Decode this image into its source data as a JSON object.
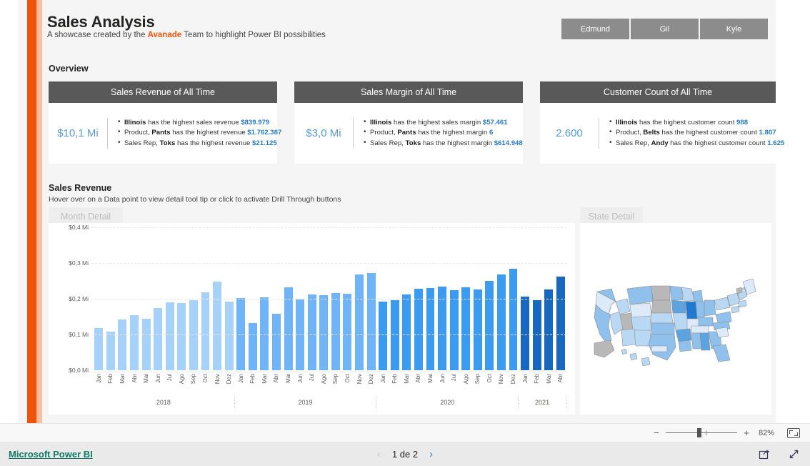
{
  "header": {
    "title": "Sales Analysis",
    "subtitle_before": "A showcase created by the ",
    "brand": "Avanade",
    "subtitle_after": " Team to highlight Power BI possibilities",
    "nav_buttons": [
      {
        "label": "Edmund"
      },
      {
        "label": "Gil"
      },
      {
        "label": "Kyle"
      }
    ]
  },
  "overview": {
    "label": "Overview",
    "cards": [
      {
        "title": "Sales Revenue of All Time",
        "value": "$10,1 Mi",
        "bullets": [
          {
            "bold": "Illinois",
            "text": " has the highest sales revenue ",
            "highlight": "$839.979",
            "prefix": ""
          },
          {
            "bold": "Pants",
            "text": " has the highest revenue ",
            "highlight": "$1.762.387",
            "prefix": "Product, "
          },
          {
            "bold": "Toks",
            "text": " has the highest revenue ",
            "highlight": "$21.125",
            "prefix": "Sales Rep, "
          }
        ]
      },
      {
        "title": "Sales Margin of All Time",
        "value": "$3,0 Mi",
        "bullets": [
          {
            "bold": "Illinois",
            "text": " has the highest sales margin ",
            "highlight": "$57.461",
            "prefix": ""
          },
          {
            "bold": "Pants",
            "text": " has the highest margin ",
            "highlight": "6",
            "prefix": "Product, "
          },
          {
            "bold": "Toks",
            "text": " has the highest margin ",
            "highlight": "$614.948",
            "prefix": "Sales Rep, "
          }
        ]
      },
      {
        "title": "Customer Count of All Time",
        "value": "2.600",
        "bullets": [
          {
            "bold": "Illinois",
            "text": " has the highest customer count ",
            "highlight": "988",
            "prefix": ""
          },
          {
            "bold": "Belts",
            "text": " has the highest customer count ",
            "highlight": "1.807",
            "prefix": "Product, "
          },
          {
            "bold": "Andy",
            "text": " has the highest customer count ",
            "highlight": "1.625",
            "prefix": "Sales Rep, "
          }
        ]
      }
    ]
  },
  "sales_revenue": {
    "label": "Sales Revenue",
    "hint": "Hover over on a Data point to view detail tool tip or click to activate Drill Through buttons",
    "month_tab": "Month Detail",
    "state_tab": "State Detail"
  },
  "chart_data": {
    "type": "bar",
    "title": "Sales Revenue",
    "xlabel": "",
    "ylabel": "",
    "ylim": [
      0,
      0.4
    ],
    "grid": true,
    "legend": "none",
    "ytick_labels": [
      "$0,4 Mi",
      "$0,3 Mi",
      "$0,2 Mi",
      "$0,1 Mi",
      "$0,0 Mi"
    ],
    "ytick_values": [
      0.4,
      0.3,
      0.2,
      0.1,
      0.0
    ],
    "year_groups": [
      {
        "year": "2018",
        "count": 12
      },
      {
        "year": "2019",
        "count": 12
      },
      {
        "year": "2020",
        "count": 12
      },
      {
        "year": "2021",
        "count": 4
      }
    ],
    "series_colors": {
      "2018": "#a6d2fa",
      "2019": "#6fb4f7",
      "2020": "#3a9bf0",
      "2021": "#1868c0"
    },
    "points": [
      {
        "x": "Jan",
        "year": "2018",
        "value": 0.118
      },
      {
        "x": "Feb",
        "year": "2018",
        "value": 0.108
      },
      {
        "x": "Mar",
        "year": "2018",
        "value": 0.143
      },
      {
        "x": "Abr",
        "year": "2018",
        "value": 0.155
      },
      {
        "x": "Mai",
        "year": "2018",
        "value": 0.144
      },
      {
        "x": "Jun",
        "year": "2018",
        "value": 0.175
      },
      {
        "x": "Jul",
        "year": "2018",
        "value": 0.191
      },
      {
        "x": "Ago",
        "year": "2018",
        "value": 0.188
      },
      {
        "x": "Sep",
        "year": "2018",
        "value": 0.196
      },
      {
        "x": "Oct",
        "year": "2018",
        "value": 0.218
      },
      {
        "x": "Nov",
        "year": "2018",
        "value": 0.248
      },
      {
        "x": "Dez",
        "year": "2018",
        "value": 0.192
      },
      {
        "x": "Jan",
        "year": "2019",
        "value": 0.202
      },
      {
        "x": "Feb",
        "year": "2019",
        "value": 0.133
      },
      {
        "x": "Mar",
        "year": "2019",
        "value": 0.204
      },
      {
        "x": "Abr",
        "year": "2019",
        "value": 0.159
      },
      {
        "x": "Mai",
        "year": "2019",
        "value": 0.232
      },
      {
        "x": "Jun",
        "year": "2019",
        "value": 0.198
      },
      {
        "x": "Jul",
        "year": "2019",
        "value": 0.212
      },
      {
        "x": "Ago",
        "year": "2019",
        "value": 0.21
      },
      {
        "x": "Sep",
        "year": "2019",
        "value": 0.216
      },
      {
        "x": "Oct",
        "year": "2019",
        "value": 0.214
      },
      {
        "x": "Nov",
        "year": "2019",
        "value": 0.268
      },
      {
        "x": "Dez",
        "year": "2019",
        "value": 0.272
      },
      {
        "x": "Jan",
        "year": "2020",
        "value": 0.193
      },
      {
        "x": "Feb",
        "year": "2020",
        "value": 0.196
      },
      {
        "x": "Mar",
        "year": "2020",
        "value": 0.212
      },
      {
        "x": "Abr",
        "year": "2020",
        "value": 0.228
      },
      {
        "x": "Mai",
        "year": "2020",
        "value": 0.231
      },
      {
        "x": "Jun",
        "year": "2020",
        "value": 0.235
      },
      {
        "x": "Jul",
        "year": "2020",
        "value": 0.224
      },
      {
        "x": "Ago",
        "year": "2020",
        "value": 0.233
      },
      {
        "x": "Sep",
        "year": "2020",
        "value": 0.226
      },
      {
        "x": "Oct",
        "year": "2020",
        "value": 0.251
      },
      {
        "x": "Nov",
        "year": "2020",
        "value": 0.268
      },
      {
        "x": "Dez",
        "year": "2020",
        "value": 0.285
      },
      {
        "x": "Jan",
        "year": "2021",
        "value": 0.206
      },
      {
        "x": "Feb",
        "year": "2021",
        "value": 0.196
      },
      {
        "x": "Mar",
        "year": "2021",
        "value": 0.226
      },
      {
        "x": "Abr",
        "year": "2021",
        "value": 0.262
      }
    ]
  },
  "map": {
    "highlight_state": "Illinois",
    "colors": {
      "darkest": "#1f7ad1",
      "dark": "#5ca3e0",
      "mid": "#8fc1ec",
      "light": "#b9d8f4",
      "lightest": "#dceaf9",
      "none": "#b8b8b8",
      "stroke": "#8d8d8d"
    }
  },
  "zoom_bar": {
    "minus": "−",
    "plus": "+",
    "percent": "82%"
  },
  "status_bar": {
    "brand_link": "Microsoft Power BI",
    "prev": "‹",
    "next": "›",
    "page_label": "1 de 2"
  }
}
